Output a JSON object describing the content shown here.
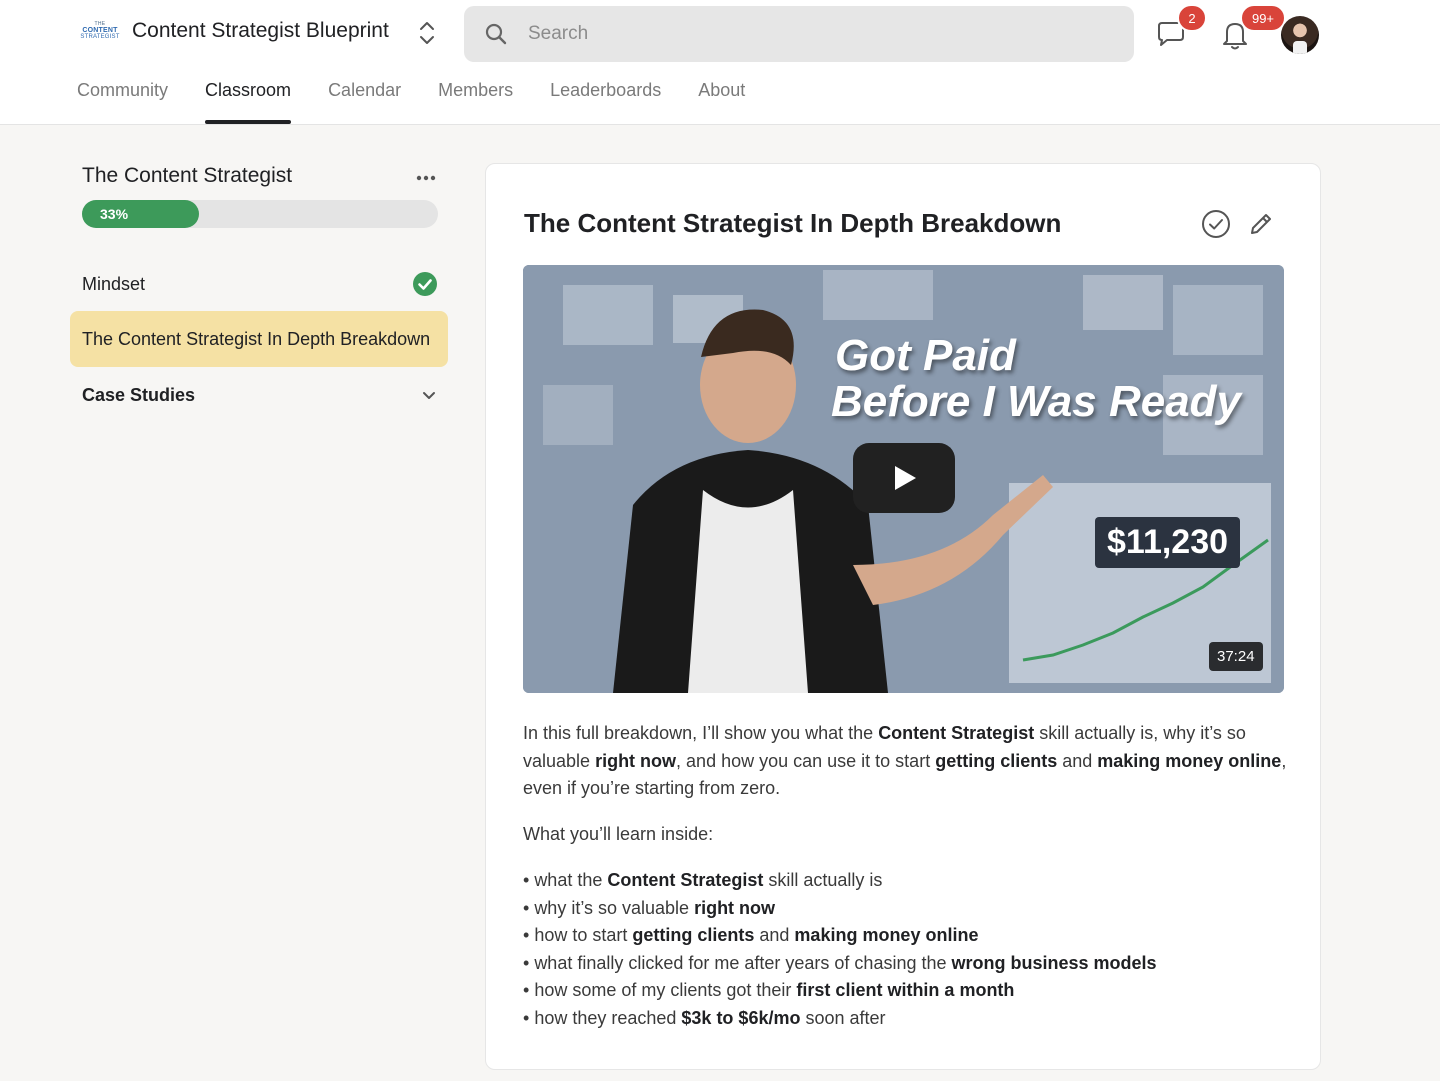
{
  "header": {
    "logo_lines": [
      "THE",
      "CONTENT",
      "STRATEGIST"
    ],
    "group_title": "Content Strategist Blueprint",
    "search_placeholder": "Search",
    "chat_badge": "2",
    "notif_badge": "99+"
  },
  "tabs": [
    "Community",
    "Classroom",
    "Calendar",
    "Members",
    "Leaderboards",
    "About"
  ],
  "active_tab": "Classroom",
  "sidebar": {
    "course_title": "The Content Strategist",
    "progress_label": "33%",
    "progress": 0.33,
    "lessons": [
      {
        "label": "Mindset",
        "completed": true
      },
      {
        "label": "The Content Strategist In Depth Breakdown",
        "current": true
      }
    ],
    "section_label": "Case Studies"
  },
  "lesson": {
    "title": "The Content Strategist In Depth Breakdown",
    "video": {
      "headline_1": "Got Paid",
      "headline_2": "Before I Was Ready",
      "price": "$11,230",
      "duration": "37:24"
    },
    "intro": [
      {
        "t": "In this full breakdown, I’ll show you what the "
      },
      {
        "t": "Content Strategist",
        "b": true
      },
      {
        "t": " skill actually is, why it’s so valuable "
      },
      {
        "t": "right now",
        "b": true
      },
      {
        "t": ", and how you can use it to start "
      },
      {
        "t": "getting clients",
        "b": true
      },
      {
        "t": " and "
      },
      {
        "t": "making money online",
        "b": true
      },
      {
        "t": ", even if you’re starting from zero."
      }
    ],
    "learn_heading": "What you’ll learn inside:",
    "bullets": [
      [
        {
          "t": "what the "
        },
        {
          "t": "Content Strategist",
          "b": true
        },
        {
          "t": " skill actually is"
        }
      ],
      [
        {
          "t": "why it’s so valuable "
        },
        {
          "t": "right now",
          "b": true
        }
      ],
      [
        {
          "t": "how to start "
        },
        {
          "t": "getting clients",
          "b": true
        },
        {
          "t": " and "
        },
        {
          "t": "making money online",
          "b": true
        }
      ],
      [
        {
          "t": "what finally clicked for me after years of chasing the "
        },
        {
          "t": "wrong business models",
          "b": true
        }
      ],
      [
        {
          "t": "how some of my clients got their "
        },
        {
          "t": "first client within a month",
          "b": true
        }
      ],
      [
        {
          "t": "how they reached "
        },
        {
          "t": "$3k to $6k/mo",
          "b": true
        },
        {
          "t": " soon after"
        }
      ]
    ]
  },
  "colors": {
    "accent_green": "#3d9a5a",
    "badge_red": "#d9443a",
    "current_lesson_bg": "#f5e1a4"
  },
  "icons": [
    "search-icon",
    "chat-icon",
    "bell-icon",
    "switch-icon",
    "more-icon",
    "check-circle-icon",
    "mark-complete-icon",
    "edit-icon",
    "chevron-down-icon",
    "play-icon"
  ]
}
